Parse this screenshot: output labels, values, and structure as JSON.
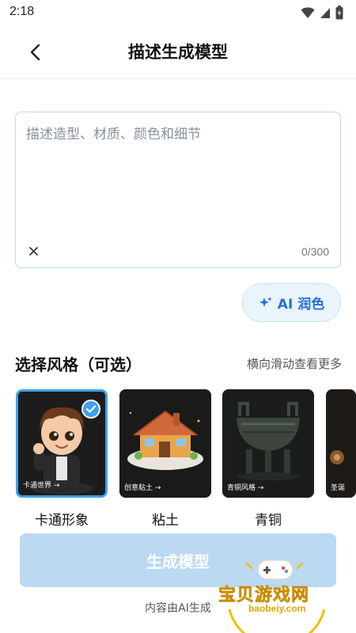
{
  "status_bar": {
    "time": "2:18"
  },
  "header": {
    "title": "描述生成模型"
  },
  "description": {
    "placeholder": "描述造型、材质、颜色和细节",
    "value": "",
    "char_count": "0/300"
  },
  "ai_polish": {
    "label": "AI 润色"
  },
  "styles": {
    "title": "选择风格（可选）",
    "hint": "横向滑动查看更多",
    "items": [
      {
        "label": "卡通形象",
        "caption": "卡通世界 →",
        "selected": true
      },
      {
        "label": "粘土",
        "caption": "创意粘土 →",
        "selected": false
      },
      {
        "label": "青铜",
        "caption": "青铜风格 →",
        "selected": false
      },
      {
        "label": "",
        "caption": "圣诞",
        "selected": false
      }
    ]
  },
  "generate": {
    "label": "生成模型",
    "footer": "内容由AI生成"
  },
  "watermark": {
    "text": "宝贝游戏网",
    "url": "baobeiy.com"
  },
  "colors": {
    "accent": "#3ea0f0",
    "button_disabled": "#bcd9f2",
    "ai_text": "#2a6fd6"
  }
}
